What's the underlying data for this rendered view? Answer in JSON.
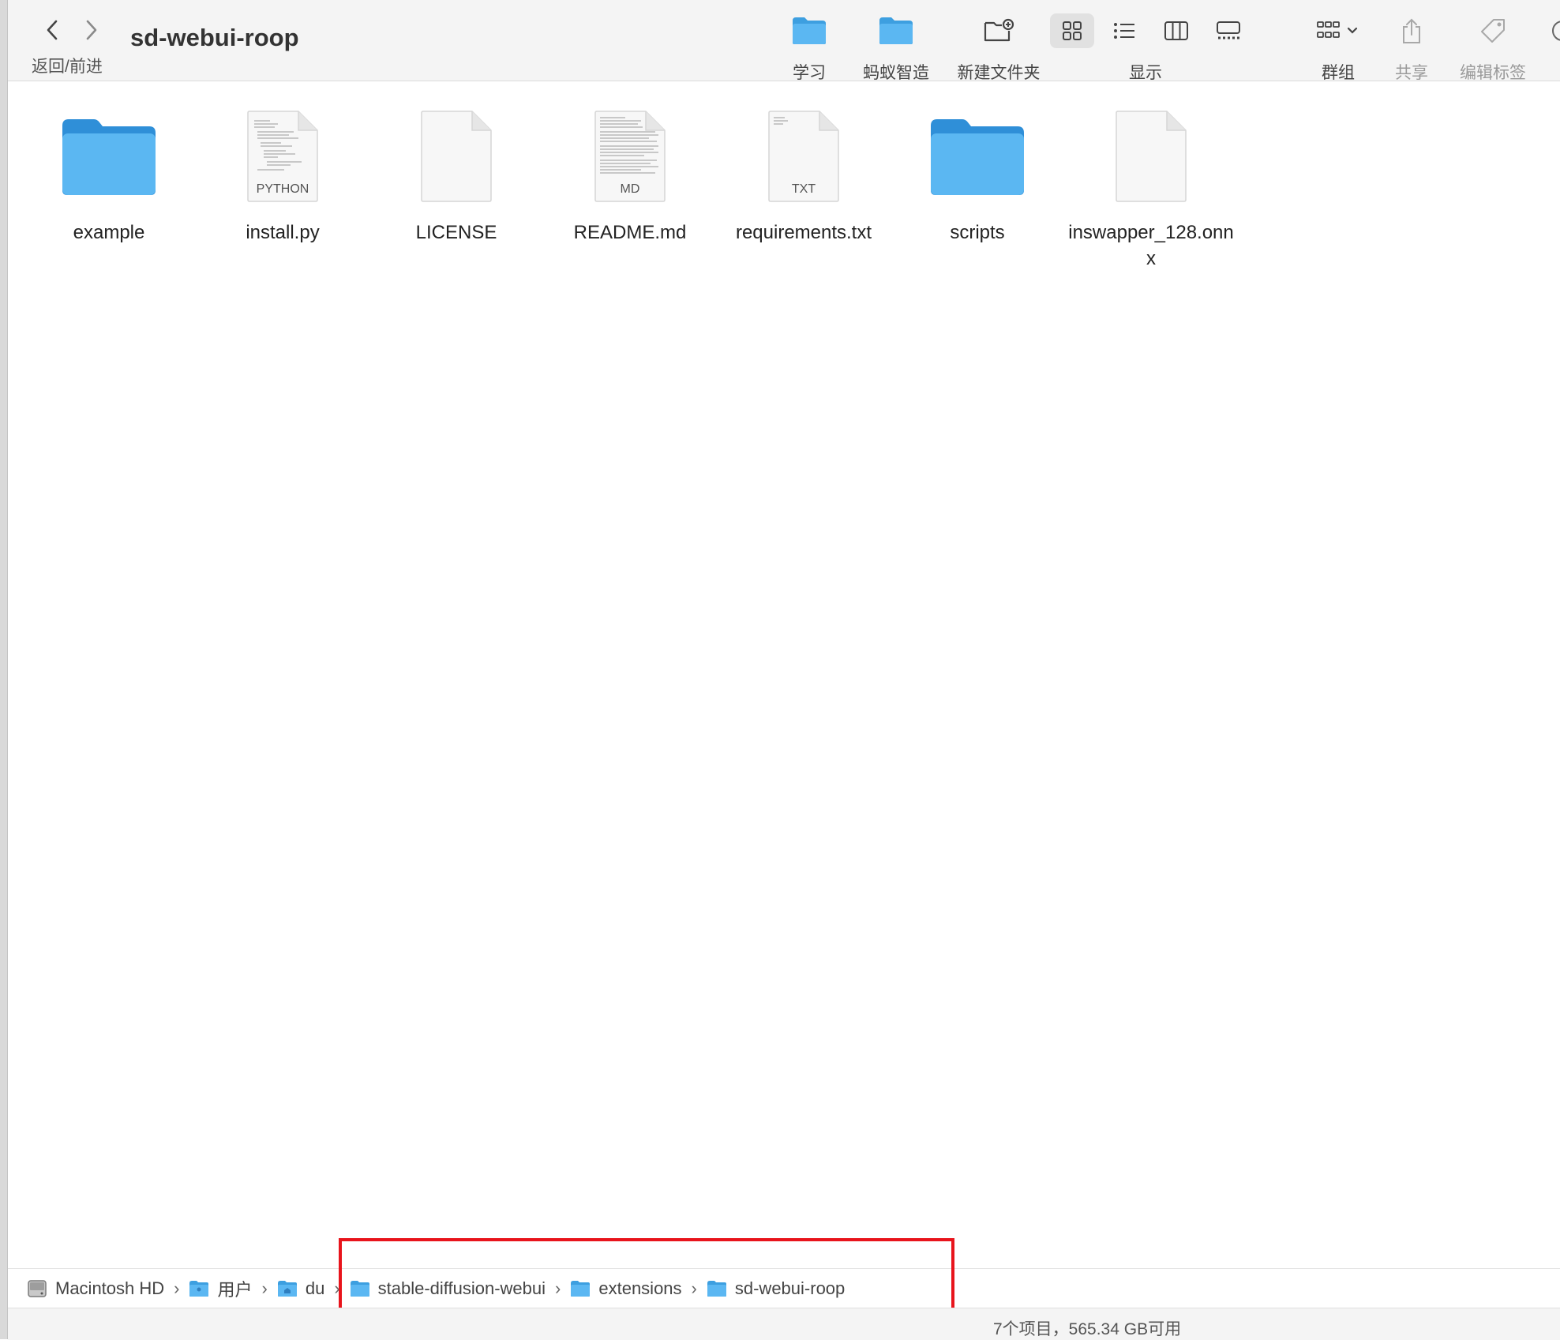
{
  "window": {
    "title": "sd-webui-roop"
  },
  "nav": {
    "label": "返回/前进"
  },
  "toolbar": {
    "fav1": "学习",
    "fav2": "蚂蚁智造",
    "new_folder": "新建文件夹",
    "view": "显示",
    "group": "群组",
    "share": "共享",
    "tags": "编辑标签"
  },
  "files": [
    {
      "name": "example",
      "kind": "folder"
    },
    {
      "name": "install.py",
      "kind": "document",
      "ext": "PYTHON"
    },
    {
      "name": "LICENSE",
      "kind": "document",
      "ext": ""
    },
    {
      "name": "README.md",
      "kind": "document",
      "ext": "MD"
    },
    {
      "name": "requirements.txt",
      "kind": "document",
      "ext": "TXT"
    },
    {
      "name": "scripts",
      "kind": "folder"
    },
    {
      "name": "inswapper_128.onnx",
      "kind": "document",
      "ext": ""
    }
  ],
  "pathbar": [
    {
      "label": "Macintosh HD",
      "icon": "disk-icon"
    },
    {
      "label": "用户",
      "icon": "folder-icon"
    },
    {
      "label": "du",
      "icon": "home-folder-icon"
    },
    {
      "label": "stable-diffusion-webui",
      "icon": "folder-icon"
    },
    {
      "label": "extensions",
      "icon": "folder-icon"
    },
    {
      "label": "sd-webui-roop",
      "icon": "folder-icon"
    }
  ],
  "status": {
    "text": "7个项目，565.34 GB可用"
  },
  "colors": {
    "folder": "#5bb7f2",
    "folder_tab": "#3d9fe0",
    "highlight": "#e8141c",
    "toolbar_bg": "#f4f4f4"
  }
}
